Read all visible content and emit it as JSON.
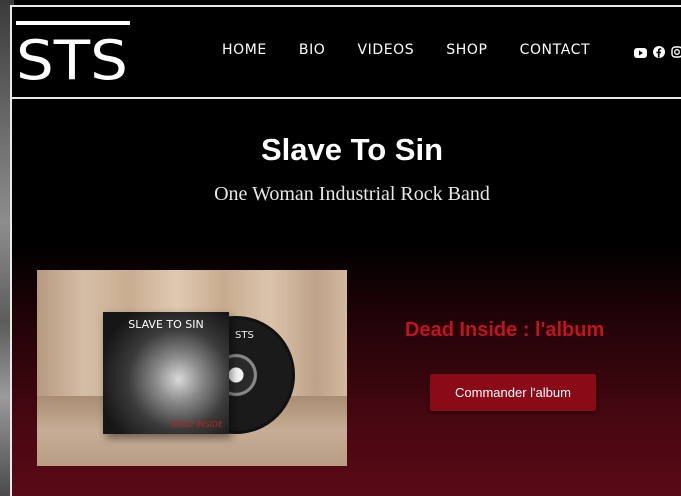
{
  "brand": {
    "logo_text": "STS"
  },
  "nav": {
    "items": [
      {
        "label": "HOME"
      },
      {
        "label": "BIO"
      },
      {
        "label": "VIDEOS"
      },
      {
        "label": "SHOP"
      },
      {
        "label": "CONTACT"
      }
    ]
  },
  "social": {
    "icons": [
      "youtube-icon",
      "facebook-icon",
      "instagram-icon"
    ]
  },
  "hero": {
    "title": "Slave To Sin",
    "subtitle": "One Woman Industrial Rock Band"
  },
  "album": {
    "cover_title": "SLAVE TO SIN",
    "cover_subtitle": "DEAD INSIDE",
    "disc_label": "STS",
    "heading": "Dead Inside : l'album",
    "button_label": "Commander l'album"
  },
  "colors": {
    "accent": "#c4121f",
    "button": "#8b0a18",
    "background": "#000000"
  }
}
